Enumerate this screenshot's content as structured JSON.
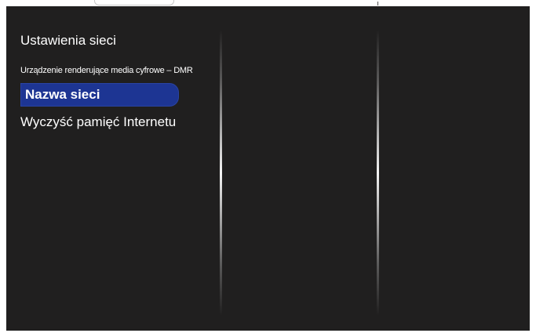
{
  "menu": {
    "items": [
      {
        "label": "Ustawienia sieci",
        "selected": false
      },
      {
        "label": "Urządzenie renderujące media cyfrowe – DMR",
        "selected": false
      },
      {
        "label": "Nazwa sieci",
        "selected": true
      },
      {
        "label": "Wyczyść pamięć Internetu",
        "selected": false
      }
    ]
  },
  "colors": {
    "background": "#201f1f",
    "highlight": "#1d3593",
    "text": "#ffffff"
  }
}
